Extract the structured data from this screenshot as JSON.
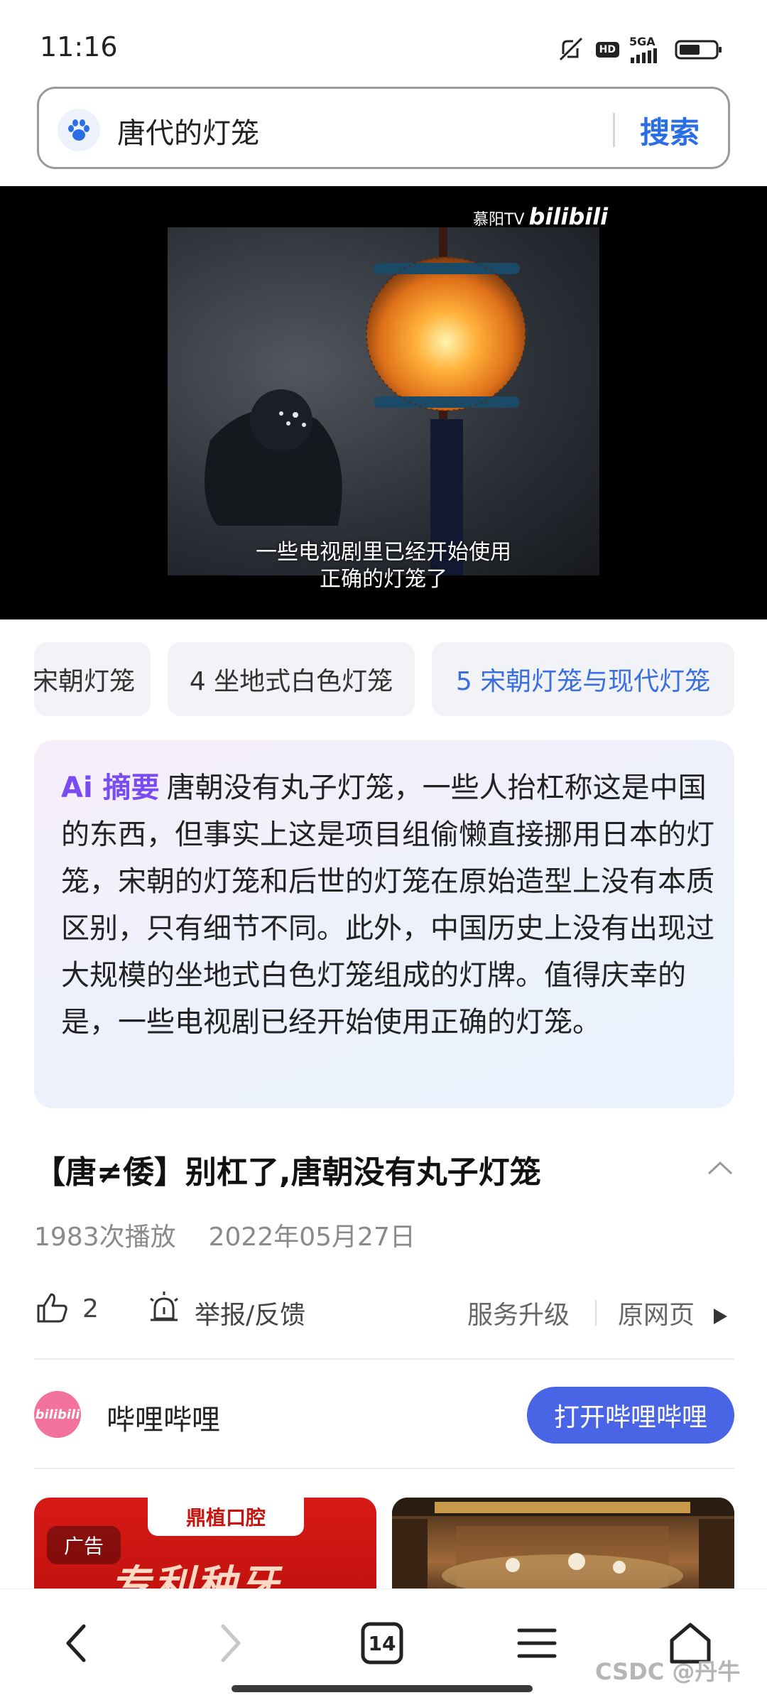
{
  "status_bar": {
    "time": "11:16",
    "hd_label": "HD",
    "network_label": "5GA"
  },
  "search": {
    "query": "唐代的灯笼",
    "button_label": "搜索"
  },
  "video": {
    "watermark_channel": "慕阳TV",
    "watermark_brand": "bilibili",
    "subtitle_line1": "一些电视剧里已经开始使用",
    "subtitle_line2": "正确的灯笼了"
  },
  "chips": [
    {
      "label": "宋朝灯笼",
      "active": false
    },
    {
      "label": "4 坐地式白色灯笼",
      "active": false
    },
    {
      "label": "5 宋朝灯笼与现代灯笼",
      "active": true
    }
  ],
  "ai_summary": {
    "tag": "Ai 摘要",
    "text": "唐朝没有丸子灯笼，一些人抬杠称这是中国的东西，但事实上这是项目组偷懒直接挪用日本的灯笼，宋朝的灯笼和后世的灯笼在原始造型上没有本质区别，只有细节不同。此外，中国历史上没有出现过大规模的坐地式白色灯笼组成的灯牌。值得庆幸的是，一些电视剧已经开始使用正确的灯笼。"
  },
  "result": {
    "title": "【唐≠倭】别杠了,唐朝没有丸子灯笼",
    "plays": "1983次播放",
    "date": "2022年05月27日"
  },
  "actions": {
    "like_count": "2",
    "report_label": "举报/反馈",
    "service_label": "服务升级",
    "origin_label": "原网页"
  },
  "source": {
    "logo_text": "bilibili",
    "name": "哔哩哔哩",
    "open_button": "打开哔哩哔哩"
  },
  "thumbnails": {
    "ad_brand": "鼎植口腔",
    "ad_badge": "广告",
    "ad_slogan": "专利种牙"
  },
  "bottom_nav": {
    "tab_count": "14",
    "watermark": "CSDC @丹牛"
  },
  "colors": {
    "accent_blue": "#2a6ee6",
    "ai_purple": "#7a4bf0",
    "open_button": "#4a64e6"
  }
}
